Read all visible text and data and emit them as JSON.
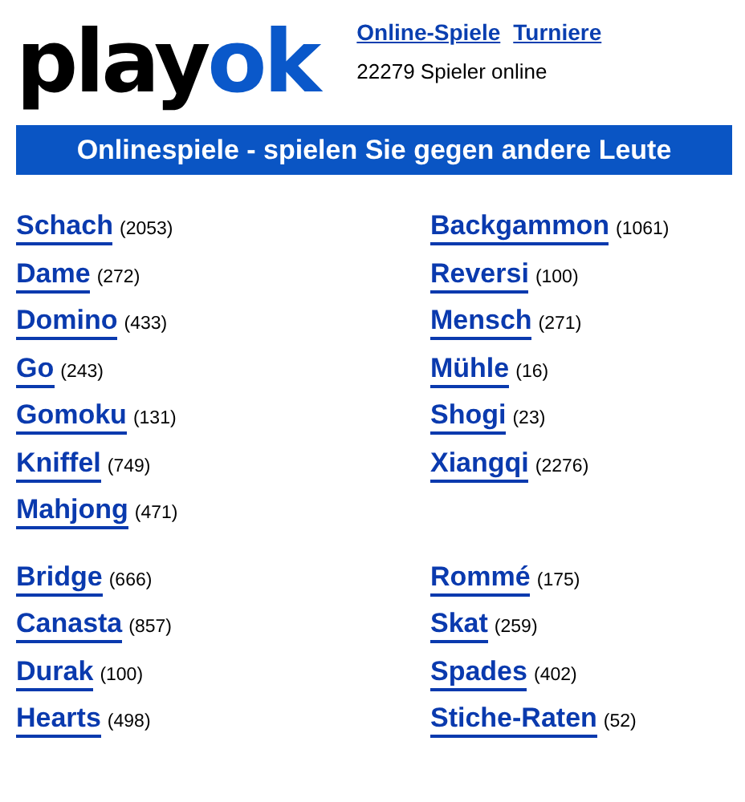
{
  "logo": {
    "dark": "play",
    "accent": "ok"
  },
  "nav_links": [
    "Online-Spiele",
    "Turniere"
  ],
  "online": {
    "count": "22279",
    "label": "Spieler online"
  },
  "banner": "Onlinespiele - spielen Sie gegen andere Leute",
  "sections": [
    {
      "left": [
        {
          "name": "Schach",
          "count": "(2053)"
        },
        {
          "name": "Dame",
          "count": "(272)"
        },
        {
          "name": "Domino",
          "count": "(433)"
        },
        {
          "name": "Go",
          "count": "(243)"
        },
        {
          "name": "Gomoku",
          "count": "(131)"
        },
        {
          "name": "Kniffel",
          "count": "(749)"
        },
        {
          "name": "Mahjong",
          "count": "(471)"
        }
      ],
      "right": [
        {
          "name": "Backgammon",
          "count": "(1061)"
        },
        {
          "name": "Reversi",
          "count": "(100)"
        },
        {
          "name": "Mensch",
          "count": "(271)"
        },
        {
          "name": "Mühle",
          "count": "(16)"
        },
        {
          "name": "Shogi",
          "count": "(23)"
        },
        {
          "name": "Xiangqi",
          "count": "(2276)"
        }
      ]
    },
    {
      "left": [
        {
          "name": "Bridge",
          "count": "(666)"
        },
        {
          "name": "Canasta",
          "count": "(857)"
        },
        {
          "name": "Durak",
          "count": "(100)"
        },
        {
          "name": "Hearts",
          "count": "(498)"
        }
      ],
      "right": [
        {
          "name": "Rommé",
          "count": "(175)"
        },
        {
          "name": "Skat",
          "count": "(259)"
        },
        {
          "name": "Spades",
          "count": "(402)"
        },
        {
          "name": "Stiche-Raten",
          "count": "(52)"
        }
      ]
    }
  ]
}
